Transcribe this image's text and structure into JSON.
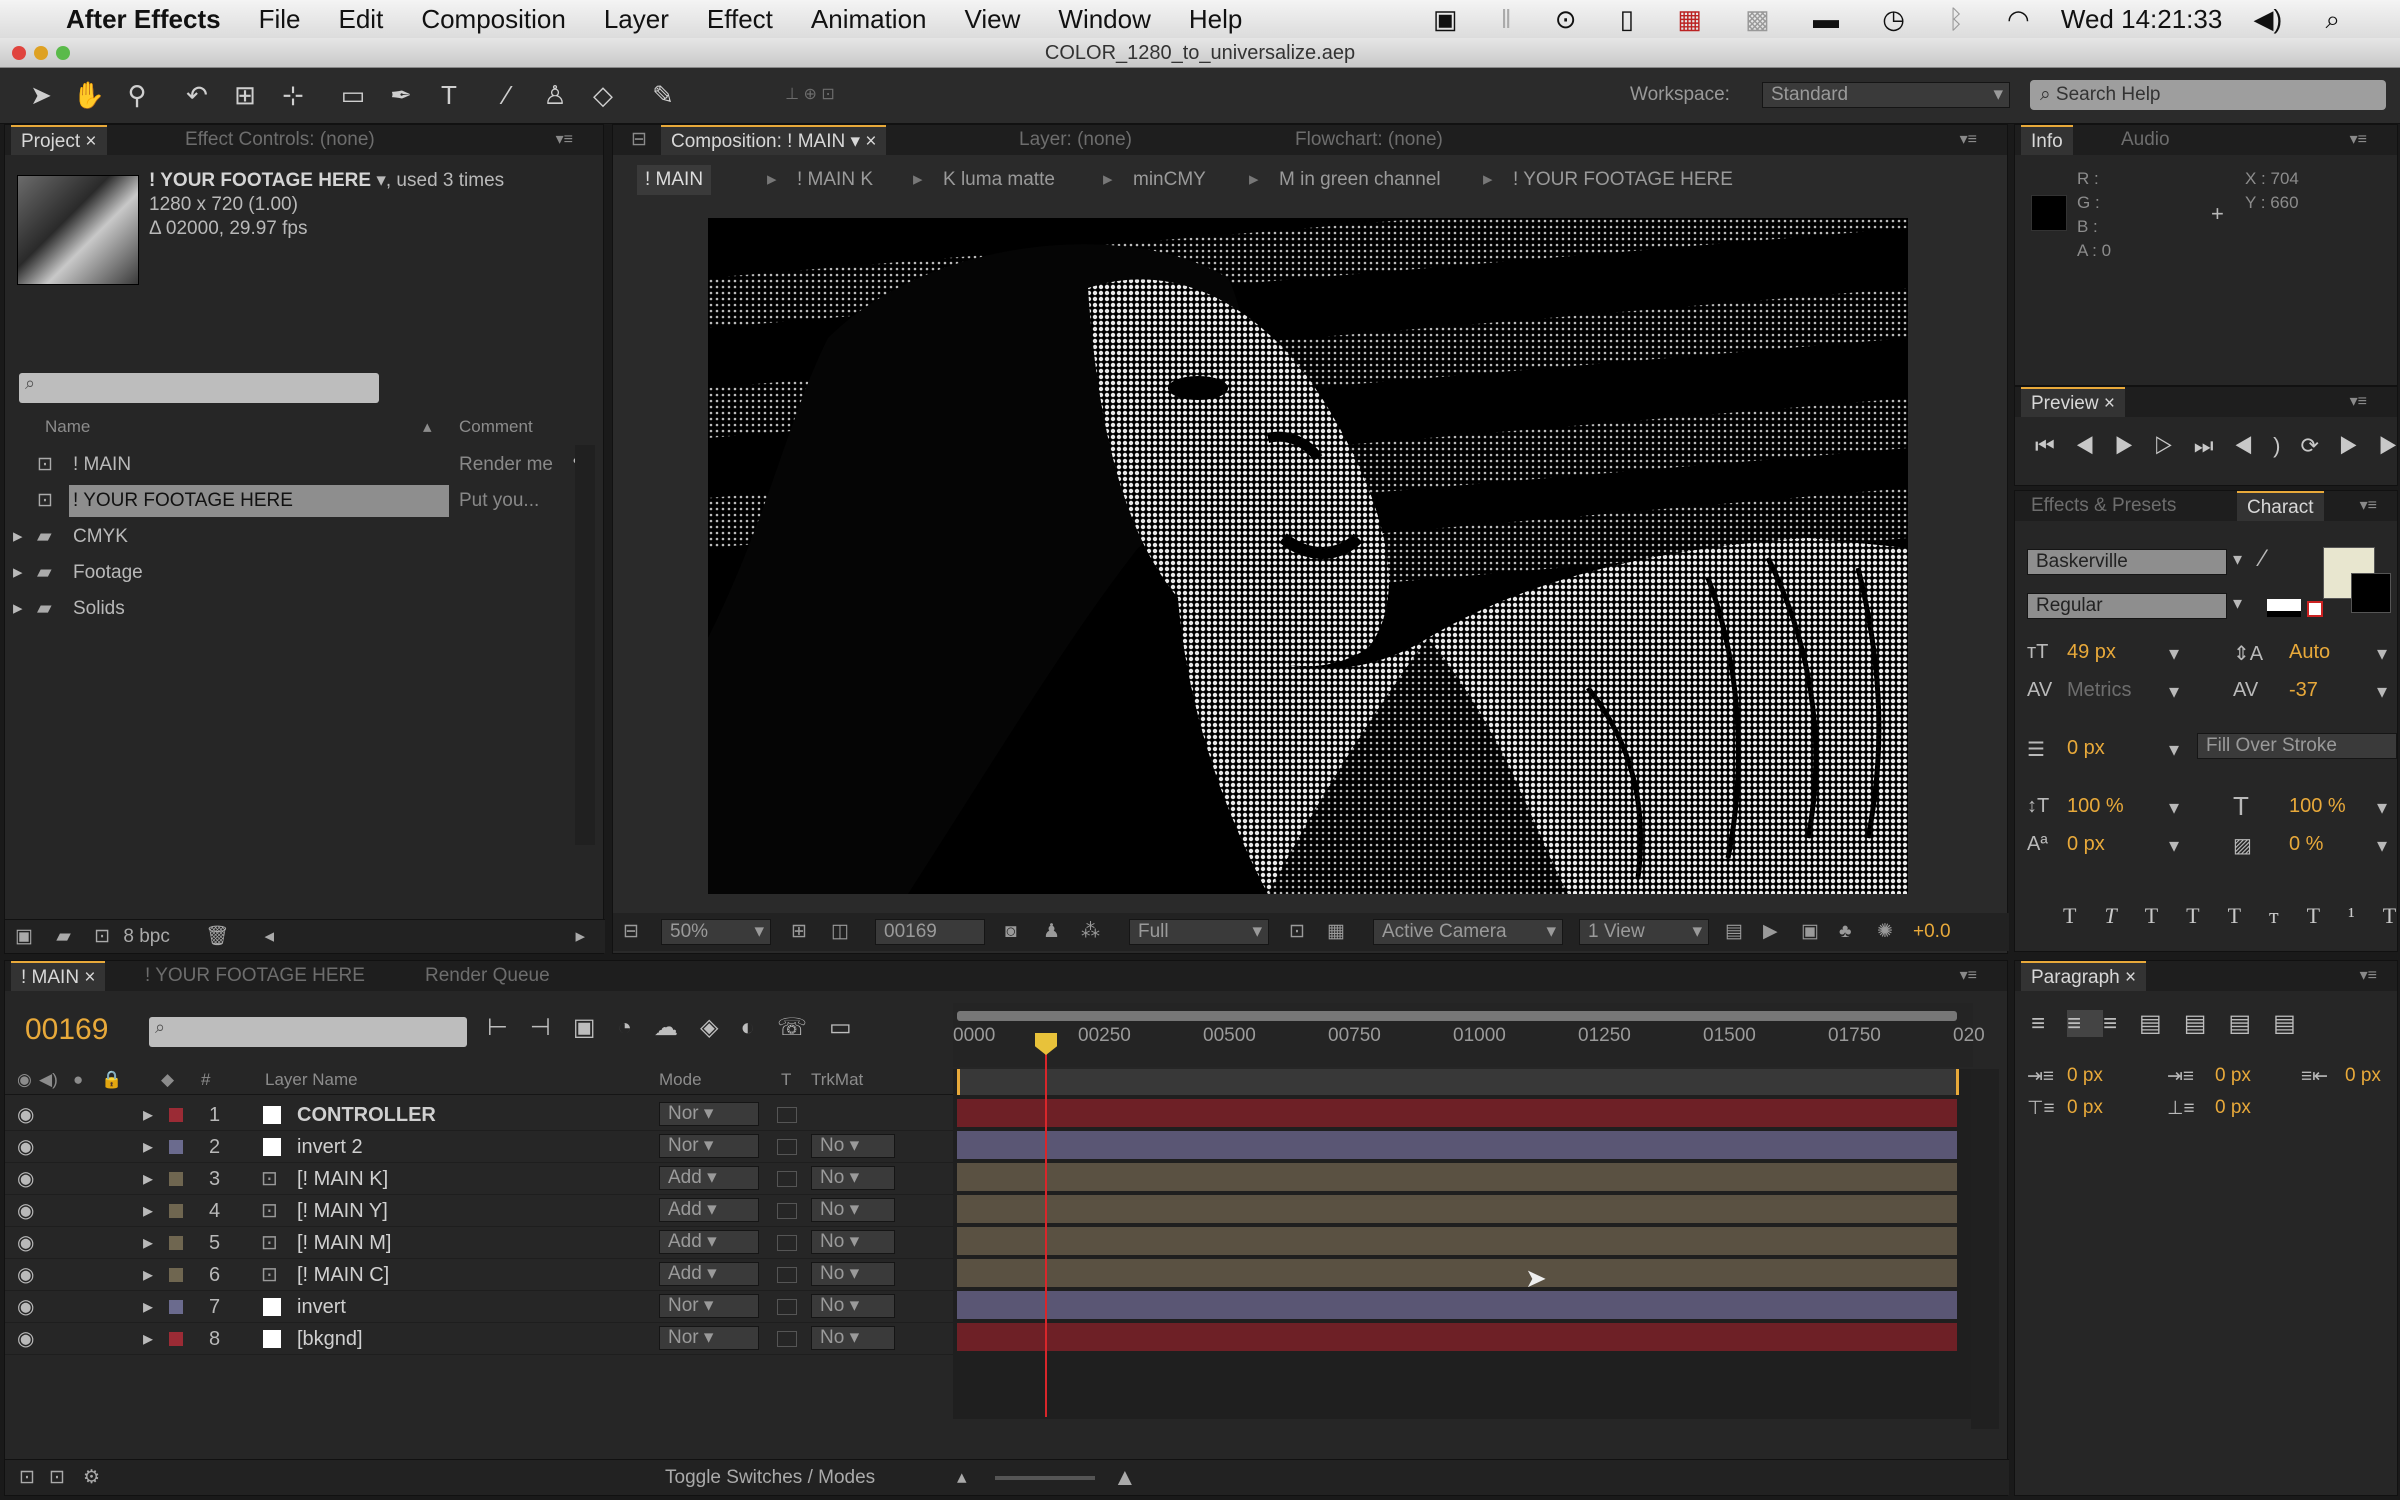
{
  "menubar": {
    "app_name": "After Effects",
    "items": [
      "File",
      "Edit",
      "Composition",
      "Layer",
      "Effect",
      "Animation",
      "View",
      "Window",
      "Help"
    ],
    "clock": "Wed 14:21:33"
  },
  "window": {
    "title": "COLOR_1280_to_universalize.aep"
  },
  "toolbar": {
    "workspace_label": "Workspace:",
    "workspace_value": "Standard",
    "search_placeholder": "Search Help"
  },
  "project": {
    "tab_project": "Project",
    "tab_effect_controls": "Effect Controls: (none)",
    "footage_name": "! YOUR FOOTAGE HERE",
    "footage_used": ", used 3 times",
    "footage_size": "1280 x 720 (1.00)",
    "footage_duration": "Δ 02000, 29.97 fps",
    "col_name": "Name",
    "col_comment": "Comment",
    "items": [
      {
        "name": "! MAIN",
        "comment": "Render me",
        "type": "comp"
      },
      {
        "name": "! YOUR FOOTAGE HERE",
        "comment": "Put you...",
        "type": "comp"
      },
      {
        "name": "CMYK",
        "comment": "",
        "type": "folder"
      },
      {
        "name": "Footage",
        "comment": "",
        "type": "folder"
      },
      {
        "name": "Solids",
        "comment": "",
        "type": "folder"
      }
    ],
    "bpc": "8 bpc"
  },
  "comp_viewer": {
    "tab_comp": "Composition: ! MAIN",
    "tab_layer": "Layer: (none)",
    "tab_flowchart": "Flowchart: (none)",
    "breadcrumbs": [
      "! MAIN",
      "! MAIN K",
      "K luma matte",
      "minCMY",
      "M in green channel",
      "! YOUR FOOTAGE HERE"
    ],
    "zoom": "50%",
    "timecode": "00169",
    "resolution": "Full",
    "camera": "Active Camera",
    "views": "1 View",
    "exposure": "+0.0"
  },
  "info": {
    "tab_info": "Info",
    "tab_audio": "Audio",
    "r": "R :",
    "g": "G :",
    "b": "B :",
    "a": "A : 0",
    "x": "X : 704",
    "y": "Y : 660"
  },
  "preview": {
    "tab": "Preview"
  },
  "character": {
    "tab_effects": "Effects & Presets",
    "tab_character": "Charact",
    "font": "Baskerville",
    "style": "Regular",
    "size": "49 px",
    "leading": "Auto",
    "kerning": "Metrics",
    "tracking": "-37",
    "stroke": "0 px",
    "stroke_type": "Fill Over Stroke",
    "vscale": "100 %",
    "hscale": "100 %",
    "baseline": "0 px",
    "tsume": "0 %"
  },
  "paragraph": {
    "tab": "Paragraph",
    "indent_values": [
      "0 px",
      "0 px",
      "0 px",
      "0 px",
      "0 px"
    ]
  },
  "timeline": {
    "tab_main": "! MAIN",
    "tab_footage": "! YOUR FOOTAGE HERE",
    "tab_render": "Render Queue",
    "timecode": "00169",
    "ruler": [
      "0000",
      "00250",
      "00500",
      "00750",
      "01000",
      "01250",
      "01500",
      "01750",
      "020"
    ],
    "col_layer_name": "Layer Name",
    "col_mode": "Mode",
    "col_t": "T",
    "col_trkmat": "TrkMat",
    "toggle_label": "Toggle Switches / Modes",
    "layers": [
      {
        "num": "1",
        "name": "CONTROLLER",
        "mode": "Nor",
        "trkmat": "",
        "label_color": "#9b2b35",
        "bar_color": "#6e2026",
        "type": "solid"
      },
      {
        "num": "2",
        "name": "invert 2",
        "mode": "Nor",
        "trkmat": "No",
        "label_color": "#6b6b8e",
        "bar_color": "#5a5674",
        "type": "solid"
      },
      {
        "num": "3",
        "name": "[! MAIN K]",
        "mode": "Add",
        "trkmat": "No",
        "label_color": "#6f6650",
        "bar_color": "#5a5142",
        "type": "comp"
      },
      {
        "num": "4",
        "name": "[! MAIN Y]",
        "mode": "Add",
        "trkmat": "No",
        "label_color": "#6f6650",
        "bar_color": "#5a5142",
        "type": "comp"
      },
      {
        "num": "5",
        "name": "[! MAIN M]",
        "mode": "Add",
        "trkmat": "No",
        "label_color": "#6f6650",
        "bar_color": "#5a5142",
        "type": "comp"
      },
      {
        "num": "6",
        "name": "[! MAIN C]",
        "mode": "Add",
        "trkmat": "No",
        "label_color": "#6f6650",
        "bar_color": "#5a5142",
        "type": "comp"
      },
      {
        "num": "7",
        "name": "invert",
        "mode": "Nor",
        "trkmat": "No",
        "label_color": "#6b6b8e",
        "bar_color": "#5a5674",
        "type": "solid"
      },
      {
        "num": "8",
        "name": "[bkgnd]",
        "mode": "Nor",
        "trkmat": "No",
        "label_color": "#9b2b35",
        "bar_color": "#6e2026",
        "type": "solid"
      }
    ]
  }
}
